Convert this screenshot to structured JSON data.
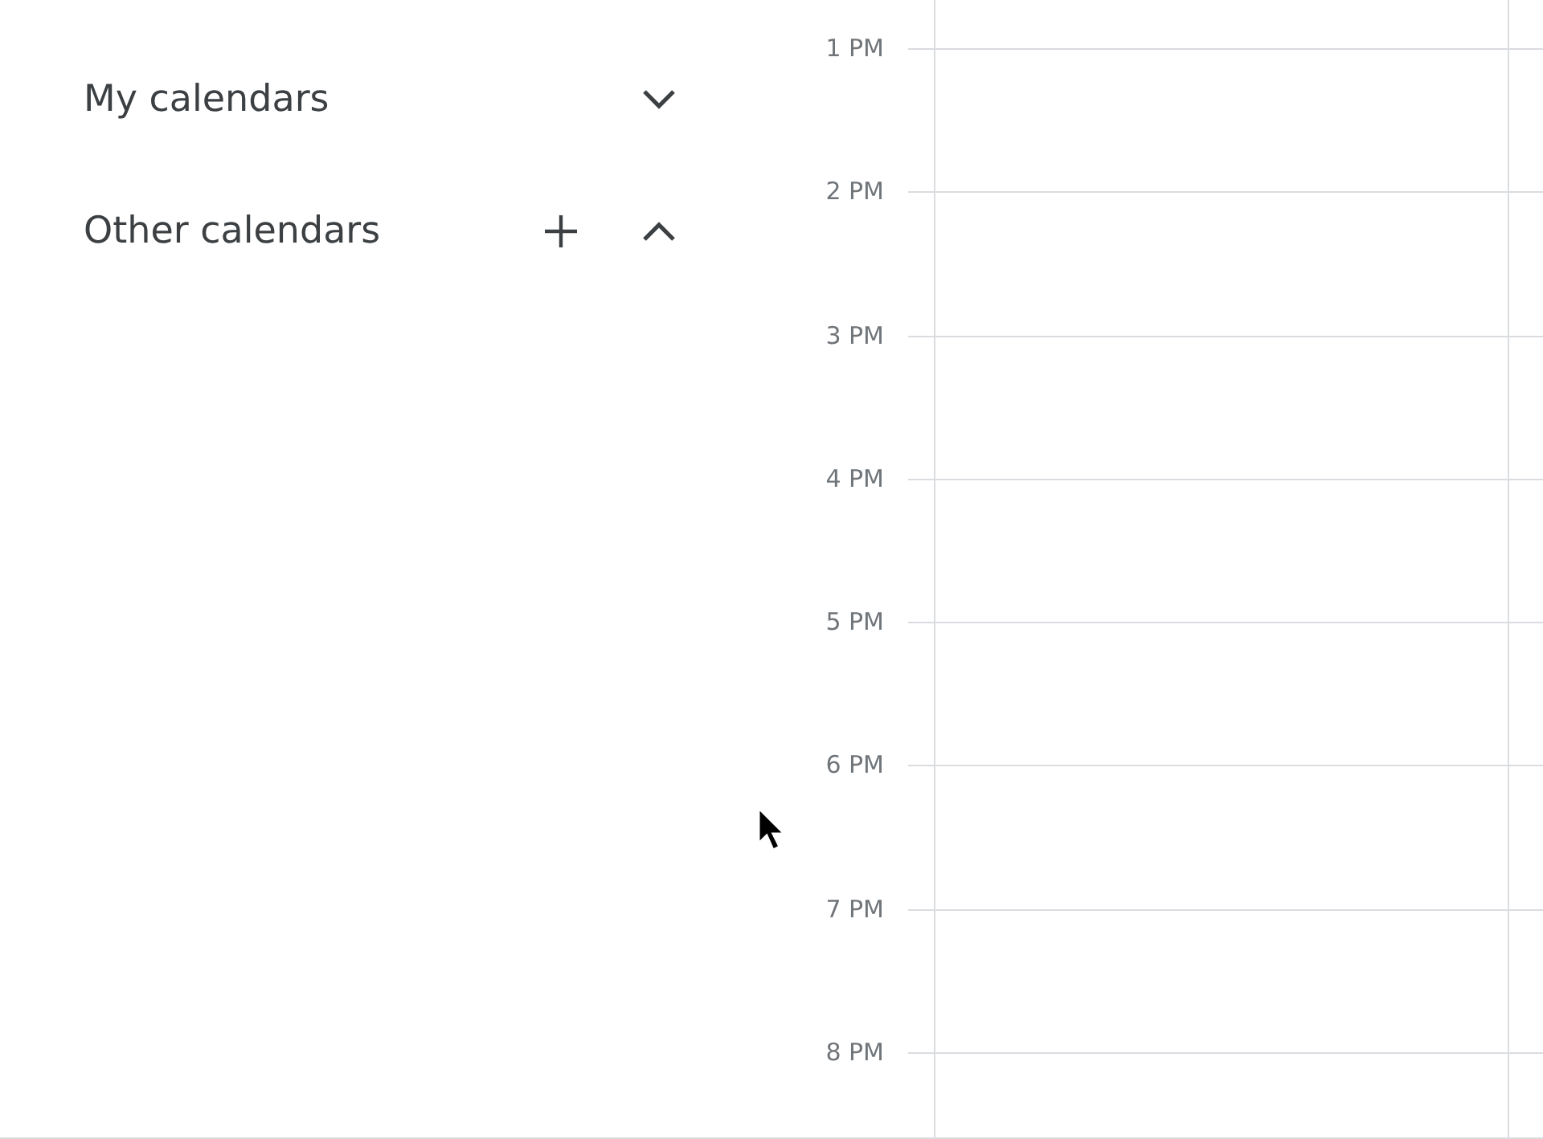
{
  "sidebar": {
    "sections": [
      {
        "title": "My calendars",
        "expanded": false,
        "has_add": false
      },
      {
        "title": "Other calendars",
        "expanded": true,
        "has_add": true
      }
    ]
  },
  "time_grid": {
    "hours": [
      "1 PM",
      "2 PM",
      "3 PM",
      "4 PM",
      "5 PM",
      "6 PM",
      "7 PM",
      "8 PM"
    ]
  }
}
